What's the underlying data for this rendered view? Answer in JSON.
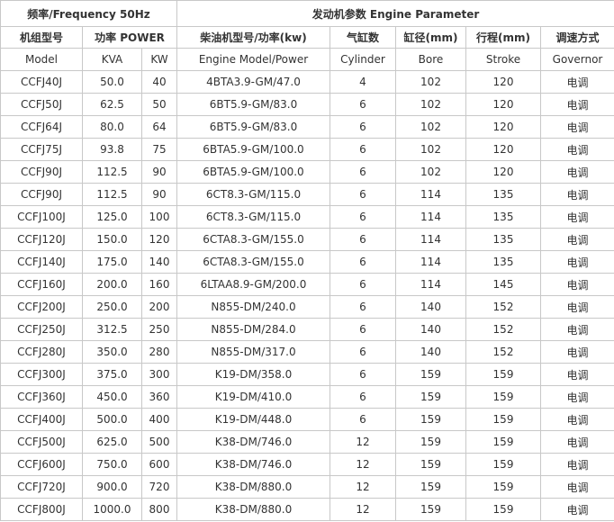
{
  "header": {
    "frequency": "频率/Frequency 50Hz",
    "engine_parameter": "发动机参数 Engine Parameter",
    "col_model_cn": "机组型号",
    "col_power_cn": "功率 POWER",
    "col_engine_cn": "柴油机型号/功率(kw)",
    "col_cylinder_cn": "气缸数",
    "col_bore_cn": "缸径(mm)",
    "col_stroke_cn": "行程(mm)",
    "col_governor_cn": "调速方式",
    "sub_model": "Model",
    "sub_kva": "KVA",
    "sub_kw": "KW",
    "sub_engine": "Engine Model/Power",
    "sub_cylinder": "Cylinder",
    "sub_bore": "Bore",
    "sub_stroke": "Stroke",
    "sub_governor": "Governor"
  },
  "rows": [
    {
      "model": "CCFJ40J",
      "kva": "50.0",
      "kw": "40",
      "engine": "4BTA3.9-GM/47.0",
      "cyl": "4",
      "bore": "102",
      "stroke": "120",
      "gov": "电调"
    },
    {
      "model": "CCFJ50J",
      "kva": "62.5",
      "kw": "50",
      "engine": "6BT5.9-GM/83.0",
      "cyl": "6",
      "bore": "102",
      "stroke": "120",
      "gov": "电调"
    },
    {
      "model": "CCFJ64J",
      "kva": "80.0",
      "kw": "64",
      "engine": "6BT5.9-GM/83.0",
      "cyl": "6",
      "bore": "102",
      "stroke": "120",
      "gov": "电调"
    },
    {
      "model": "CCFJ75J",
      "kva": "93.8",
      "kw": "75",
      "engine": "6BTA5.9-GM/100.0",
      "cyl": "6",
      "bore": "102",
      "stroke": "120",
      "gov": "电调"
    },
    {
      "model": "CCFJ90J",
      "kva": "112.5",
      "kw": "90",
      "engine": "6BTA5.9-GM/100.0",
      "cyl": "6",
      "bore": "102",
      "stroke": "120",
      "gov": "电调"
    },
    {
      "model": "CCFJ90J",
      "kva": "112.5",
      "kw": "90",
      "engine": "6CT8.3-GM/115.0",
      "cyl": "6",
      "bore": "114",
      "stroke": "135",
      "gov": "电调"
    },
    {
      "model": "CCFJ100J",
      "kva": "125.0",
      "kw": "100",
      "engine": "6CT8.3-GM/115.0",
      "cyl": "6",
      "bore": "114",
      "stroke": "135",
      "gov": "电调"
    },
    {
      "model": "CCFJ120J",
      "kva": "150.0",
      "kw": "120",
      "engine": "6CTA8.3-GM/155.0",
      "cyl": "6",
      "bore": "114",
      "stroke": "135",
      "gov": "电调"
    },
    {
      "model": "CCFJ140J",
      "kva": "175.0",
      "kw": "140",
      "engine": "6CTA8.3-GM/155.0",
      "cyl": "6",
      "bore": "114",
      "stroke": "135",
      "gov": "电调"
    },
    {
      "model": "CCFJ160J",
      "kva": "200.0",
      "kw": "160",
      "engine": "6LTAA8.9-GM/200.0",
      "cyl": "6",
      "bore": "114",
      "stroke": "145",
      "gov": "电调"
    },
    {
      "model": "CCFJ200J",
      "kva": "250.0",
      "kw": "200",
      "engine": "N855-DM/240.0",
      "cyl": "6",
      "bore": "140",
      "stroke": "152",
      "gov": "电调"
    },
    {
      "model": "CCFJ250J",
      "kva": "312.5",
      "kw": "250",
      "engine": "N855-DM/284.0",
      "cyl": "6",
      "bore": "140",
      "stroke": "152",
      "gov": "电调"
    },
    {
      "model": "CCFJ280J",
      "kva": "350.0",
      "kw": "280",
      "engine": "N855-DM/317.0",
      "cyl": "6",
      "bore": "140",
      "stroke": "152",
      "gov": "电调"
    },
    {
      "model": "CCFJ300J",
      "kva": "375.0",
      "kw": "300",
      "engine": "K19-DM/358.0",
      "cyl": "6",
      "bore": "159",
      "stroke": "159",
      "gov": "电调"
    },
    {
      "model": "CCFJ360J",
      "kva": "450.0",
      "kw": "360",
      "engine": "K19-DM/410.0",
      "cyl": "6",
      "bore": "159",
      "stroke": "159",
      "gov": "电调"
    },
    {
      "model": "CCFJ400J",
      "kva": "500.0",
      "kw": "400",
      "engine": "K19-DM/448.0",
      "cyl": "6",
      "bore": "159",
      "stroke": "159",
      "gov": "电调"
    },
    {
      "model": "CCFJ500J",
      "kva": "625.0",
      "kw": "500",
      "engine": "K38-DM/746.0",
      "cyl": "12",
      "bore": "159",
      "stroke": "159",
      "gov": "电调"
    },
    {
      "model": "CCFJ600J",
      "kva": "750.0",
      "kw": "600",
      "engine": "K38-DM/746.0",
      "cyl": "12",
      "bore": "159",
      "stroke": "159",
      "gov": "电调"
    },
    {
      "model": "CCFJ720J",
      "kva": "900.0",
      "kw": "720",
      "engine": "K38-DM/880.0",
      "cyl": "12",
      "bore": "159",
      "stroke": "159",
      "gov": "电调"
    },
    {
      "model": "CCFJ800J",
      "kva": "1000.0",
      "kw": "800",
      "engine": "K38-DM/880.0",
      "cyl": "12",
      "bore": "159",
      "stroke": "159",
      "gov": "电调"
    }
  ]
}
